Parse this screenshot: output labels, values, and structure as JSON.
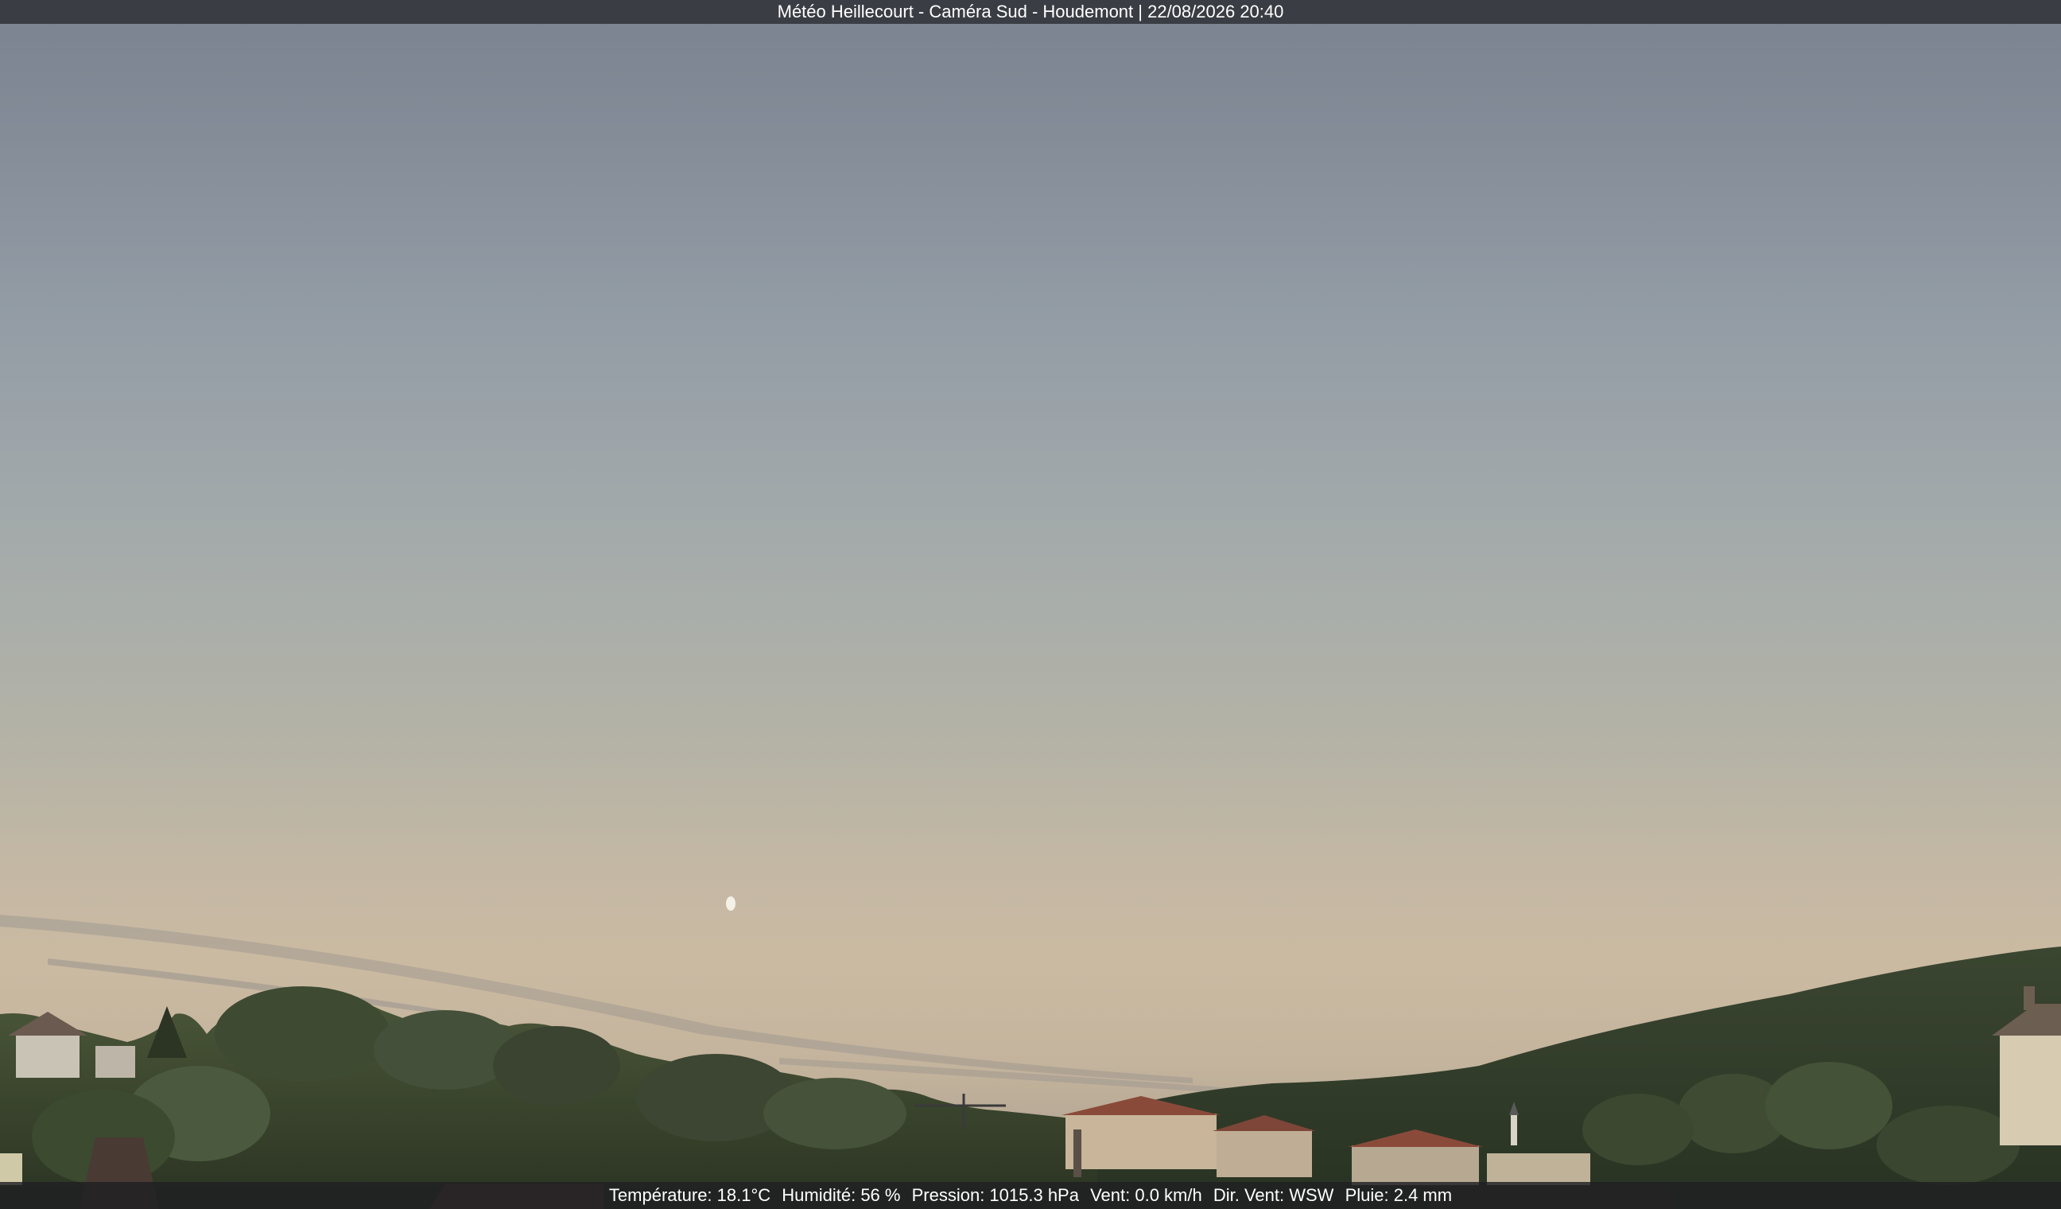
{
  "overlay": {
    "title": "Météo Heillecourt - Caméra Sud - Houdemont | 22/08/2026 20:40"
  },
  "weather": {
    "temperature": "Température: 18.1°C",
    "humidity": "Humidité: 56 %",
    "pressure": "Pression: 1015.3 hPa",
    "wind_speed": "Vent: 0.0 km/h",
    "wind_dir": "Dir. Vent: WSW",
    "rain": "Pluie: 2.4 mm"
  },
  "colors": {
    "sky_top": "#7b8290",
    "sky_horizon": "#cbbaa2",
    "foliage": "#2f3b26",
    "roof": "#8a4a3a"
  }
}
